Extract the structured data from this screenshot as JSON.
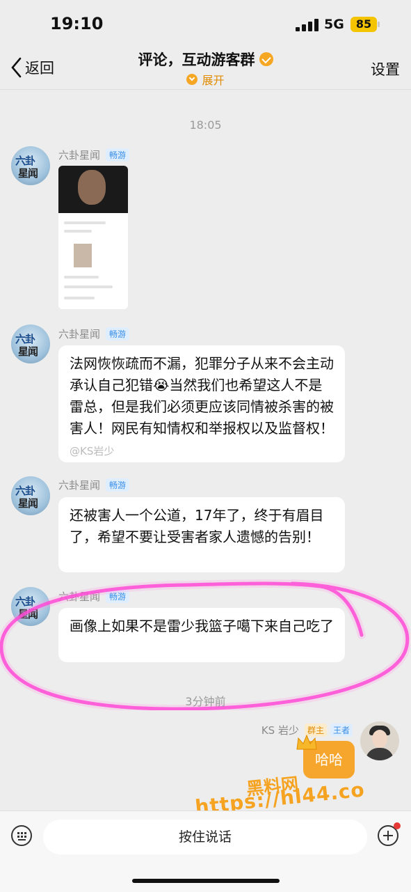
{
  "status": {
    "time": "19:10",
    "network": "5G",
    "battery": "85"
  },
  "nav": {
    "back_label": "返回",
    "title": "评论，互动游客群",
    "expand_label": "展开",
    "settings_label": "设置"
  },
  "chat": {
    "timestamp_1": "18:05",
    "messages": [
      {
        "sender": "六卦星闻",
        "tag": "畅游",
        "type": "image"
      },
      {
        "sender": "六卦星闻",
        "tag": "畅游",
        "type": "text",
        "text": "法网恢恢疏而不漏，犯罪分子从来不会主动承认自己犯错😭当然我们也希望这人不是雷总，但是我们必须更应该同情被杀害的被害人！网民有知情权和举报权以及监督权！",
        "watermark": "@KS岩少"
      },
      {
        "sender": "六卦星闻",
        "tag": "畅游",
        "type": "text",
        "text": "还被害人一个公道，17年了，终于有眉目了，希望不要让受害者家人遗憾的告别！"
      },
      {
        "sender": "六卦星闻",
        "tag": "畅游",
        "type": "text",
        "text": "画像上如果不是雷少我篮子噶下来自己吃了"
      }
    ],
    "timestamp_2": "3分钟前",
    "my_message": {
      "sender": "KS 岩少",
      "role_owner": "群主",
      "role_king": "王者",
      "text": "哈哈"
    }
  },
  "avatar_text": {
    "top": "六卦",
    "bottom": "星闻"
  },
  "brand": {
    "line1": "黑料网",
    "line2": "https://hl44.co"
  },
  "input": {
    "hold_to_talk": "按住说话"
  },
  "colors": {
    "accent": "#f7a62d",
    "highlight": "#ff2fd0"
  }
}
